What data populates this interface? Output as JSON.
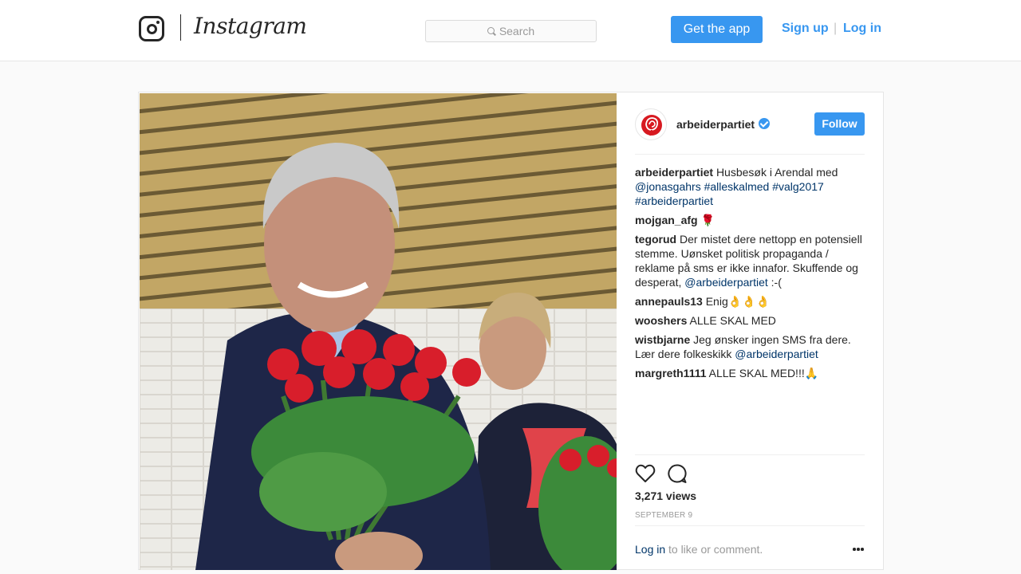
{
  "nav": {
    "wordmark": "Instagram",
    "search_placeholder": "Search",
    "get_app_label": "Get the app",
    "signup_label": "Sign up",
    "separator": "|",
    "login_label": "Log in"
  },
  "post": {
    "author": "arbeiderpartiet",
    "follow_label": "Follow",
    "caption": {
      "user": "arbeiderpartiet",
      "text": "Husbesøk i Arendal med",
      "mention": "@jonasgahrs",
      "tag1": "#alleskalmed",
      "tag2": "#valg2017",
      "tag3": "#arbeiderpartiet"
    },
    "comments": [
      {
        "user": "mojgan_afg",
        "text": "🌹"
      },
      {
        "user": "tegorud",
        "text": "Der mistet dere nettopp en potensiell stemme. Uønsket politisk propaganda / reklame på sms er ikke innafor. Skuffende og desperat,",
        "mention": "@arbeiderpartiet",
        "after": ":-("
      },
      {
        "user": "annepauls13",
        "text": "Enig👌👌👌"
      },
      {
        "user": "wooshers",
        "text": "ALLE SKAL MED"
      },
      {
        "user": "wistbjarne",
        "text": "Jeg ønsker ingen SMS fra dere. Lær dere folkeskikk",
        "mention": "@arbeiderpartiet"
      },
      {
        "user": "margreth1111",
        "text": "ALLE SKAL MED!!!🙏"
      }
    ],
    "views": "3,271 views",
    "date": "SEPTEMBER 9",
    "footer_login": "Log in",
    "footer_rest": "to like or comment."
  },
  "icons": {
    "logo": "camera-glyph-icon",
    "search": "search-icon",
    "verified": "verified-badge-icon",
    "like": "heart-icon",
    "comment": "comment-icon",
    "more": "more-options-icon"
  },
  "colors": {
    "accent": "#3897f0",
    "link": "#003569",
    "muted": "#999999"
  }
}
